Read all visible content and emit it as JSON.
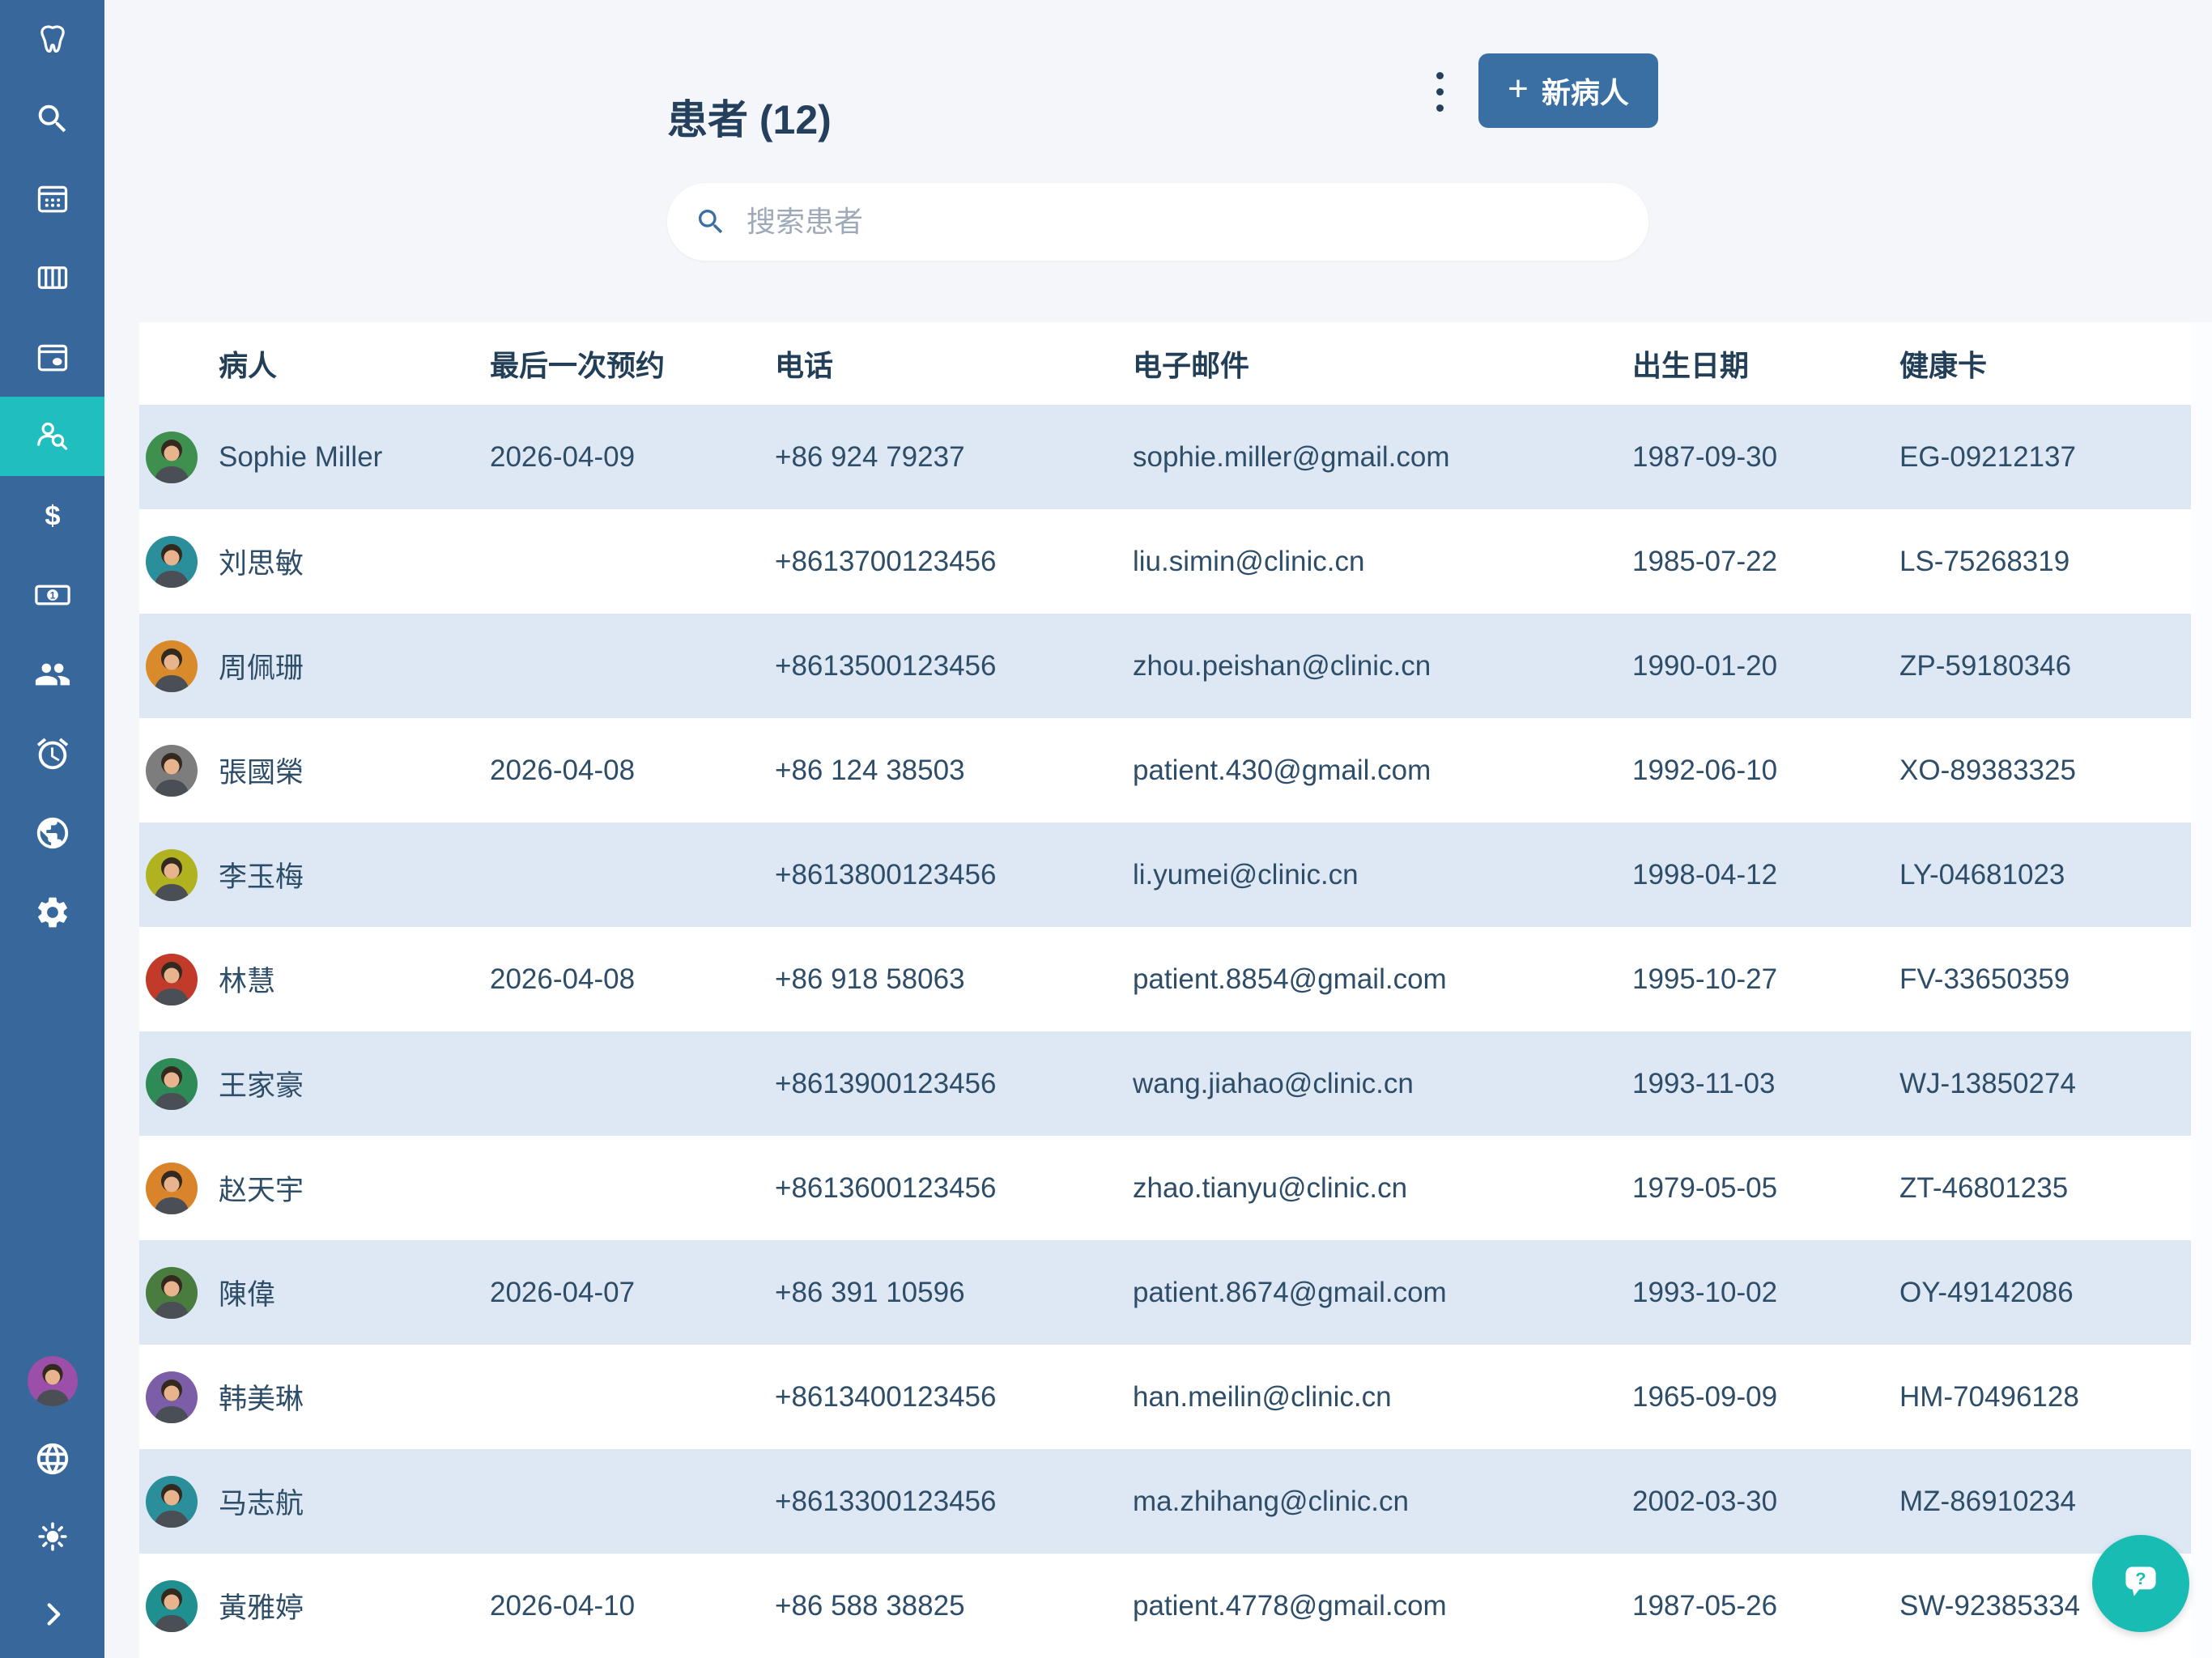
{
  "header": {
    "title": "患者 (12)",
    "new_patient_label": "新病人",
    "plus_glyph": "+"
  },
  "search": {
    "placeholder": "搜索患者"
  },
  "sidebar": {
    "items": [
      {
        "name": "tooth-logo-icon",
        "icon": "tooth",
        "active": false
      },
      {
        "name": "search-icon",
        "icon": "search",
        "active": false
      },
      {
        "name": "calendar-icon",
        "icon": "calendar",
        "active": false
      },
      {
        "name": "columns-icon",
        "icon": "columns",
        "active": false
      },
      {
        "name": "calendar-event-icon",
        "icon": "calendar-dot",
        "active": false
      },
      {
        "name": "patient-search-icon",
        "icon": "person-search",
        "active": true
      },
      {
        "name": "dollar-icon",
        "icon": "dollar",
        "active": false
      },
      {
        "name": "banknote-icon",
        "icon": "banknote",
        "active": false
      },
      {
        "name": "people-icon",
        "icon": "people",
        "active": false
      },
      {
        "name": "alarm-icon",
        "icon": "alarm",
        "active": false
      },
      {
        "name": "earth-icon",
        "icon": "earth",
        "active": false
      },
      {
        "name": "gear-icon",
        "icon": "gear",
        "active": false
      }
    ],
    "bottom_items": [
      {
        "name": "user-avatar",
        "icon": "photo-avatar",
        "avatar_color": "#9B4FA8"
      },
      {
        "name": "globe-icon",
        "icon": "globe"
      },
      {
        "name": "sun-icon",
        "icon": "sun"
      },
      {
        "name": "chevron-right-icon",
        "icon": "chevron"
      }
    ]
  },
  "table": {
    "columns": [
      "病人",
      "最后一次预约",
      "电话",
      "电子邮件",
      "出生日期",
      "健康卡"
    ],
    "rows": [
      {
        "name": "Sophie Miller",
        "last_appointment": "2026-04-09",
        "phone": "+86 924 79237",
        "email": "sophie.miller@gmail.com",
        "dob": "1987-09-30",
        "health_card": "EG-09212137",
        "avatar_color": "#3F8F4F"
      },
      {
        "name": "刘思敏",
        "last_appointment": "",
        "phone": "+8613700123456",
        "email": "liu.simin@clinic.cn",
        "dob": "1985-07-22",
        "health_card": "LS-75268319",
        "avatar_color": "#2A8F9B"
      },
      {
        "name": "周佩珊",
        "last_appointment": "",
        "phone": "+8613500123456",
        "email": "zhou.peishan@clinic.cn",
        "dob": "1990-01-20",
        "health_card": "ZP-59180346",
        "avatar_color": "#D98B2B"
      },
      {
        "name": "張國榮",
        "last_appointment": "2026-04-08",
        "phone": "+86 124 38503",
        "email": "patient.430@gmail.com",
        "dob": "1992-06-10",
        "health_card": "XO-89383325",
        "avatar_color": "#7D7D7D"
      },
      {
        "name": "李玉梅",
        "last_appointment": "",
        "phone": "+8613800123456",
        "email": "li.yumei@clinic.cn",
        "dob": "1998-04-12",
        "health_card": "LY-04681023",
        "avatar_color": "#B0B31F"
      },
      {
        "name": "林慧",
        "last_appointment": "2026-04-08",
        "phone": "+86 918 58063",
        "email": "patient.8854@gmail.com",
        "dob": "1995-10-27",
        "health_card": "FV-33650359",
        "avatar_color": "#C23B2A"
      },
      {
        "name": "王家豪",
        "last_appointment": "",
        "phone": "+8613900123456",
        "email": "wang.jiahao@clinic.cn",
        "dob": "1993-11-03",
        "health_card": "WJ-13850274",
        "avatar_color": "#2E8B57"
      },
      {
        "name": "赵天宇",
        "last_appointment": "",
        "phone": "+8613600123456",
        "email": "zhao.tianyu@clinic.cn",
        "dob": "1979-05-05",
        "health_card": "ZT-46801235",
        "avatar_color": "#D9832A"
      },
      {
        "name": "陳偉",
        "last_appointment": "2026-04-07",
        "phone": "+86 391 10596",
        "email": "patient.8674@gmail.com",
        "dob": "1993-10-02",
        "health_card": "OY-49142086",
        "avatar_color": "#4A7C3F"
      },
      {
        "name": "韩美琳",
        "last_appointment": "",
        "phone": "+8613400123456",
        "email": "han.meilin@clinic.cn",
        "dob": "1965-09-09",
        "health_card": "HM-70496128",
        "avatar_color": "#7B5EA7"
      },
      {
        "name": "马志航",
        "last_appointment": "",
        "phone": "+8613300123456",
        "email": "ma.zhihang@clinic.cn",
        "dob": "2002-03-30",
        "health_card": "MZ-86910234",
        "avatar_color": "#2A8F9B"
      },
      {
        "name": "黃雅婷",
        "last_appointment": "2026-04-10",
        "phone": "+86 588 38825",
        "email": "patient.4778@gmail.com",
        "dob": "1987-05-26",
        "health_card": "SW-92385334",
        "avatar_color": "#1F8F8F"
      }
    ]
  },
  "fab": {
    "icon": "help-chat-icon"
  },
  "colors": {
    "sidebar_bg": "#38689B",
    "active_item_teal": "#20BEBE",
    "button_blue": "#3A6FA3",
    "row_stripe_blue": "#DEE8F4",
    "text_navy": "#2E4D68",
    "header_text_navy": "#233F58",
    "fab_teal": "#19BCB2",
    "page_bg": "#F4F6F9"
  }
}
